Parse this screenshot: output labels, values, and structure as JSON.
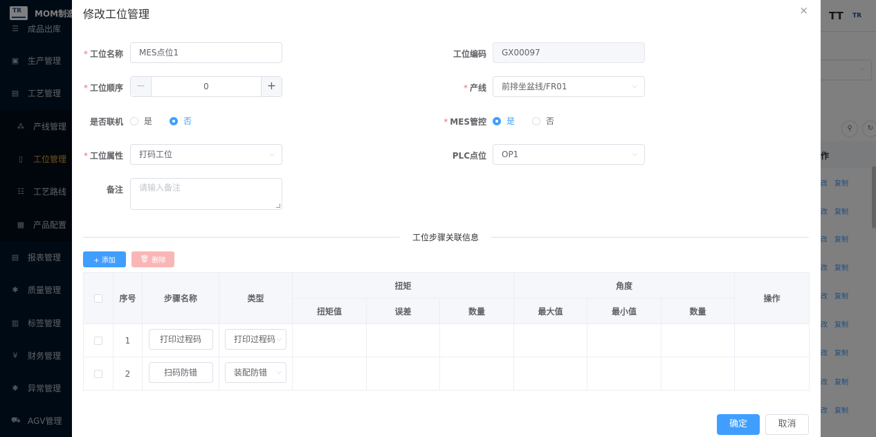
{
  "app": {
    "title": "MOM制造",
    "logo_text": "TR"
  },
  "sidebar": {
    "items": [
      {
        "label": "成品出库",
        "icon": "list-icon"
      },
      {
        "label": "生产管理",
        "icon": "box-icon"
      },
      {
        "label": "工艺管理",
        "icon": "card-icon"
      },
      {
        "label": "产线管理",
        "icon": "tree-icon"
      },
      {
        "label": "工位管理",
        "icon": "station-icon"
      },
      {
        "label": "工艺路线",
        "icon": "route-icon"
      },
      {
        "label": "产品配置",
        "icon": "config-icon"
      },
      {
        "label": "报表管理",
        "icon": "report-icon"
      },
      {
        "label": "质量管理",
        "icon": "quality-icon"
      },
      {
        "label": "标签管理",
        "icon": "tag-icon"
      },
      {
        "label": "财务管理",
        "icon": "yen-icon"
      },
      {
        "label": "异常管理",
        "icon": "alert-icon"
      },
      {
        "label": "AGV管理",
        "icon": "cart-icon"
      }
    ]
  },
  "background": {
    "toolbar_icon": "TT",
    "table_header": "作",
    "row_actions": {
      "edit": "改",
      "copy": "复制"
    }
  },
  "dialog": {
    "title": "修改工位管理",
    "close": "×",
    "form": {
      "name_label": "工位名称",
      "name_value": "MES点位1",
      "code_label": "工位编码",
      "code_value": "GX00097",
      "order_label": "工位顺序",
      "order_value": "0",
      "line_label": "产线",
      "line_value": "前排坐盆线/FR01",
      "online_label": "是否联机",
      "online_options": [
        "是",
        "否"
      ],
      "mes_label": "MES管控",
      "mes_options": [
        "是",
        "否"
      ],
      "attr_label": "工位属性",
      "attr_value": "打码工位",
      "plc_label": "PLC点位",
      "plc_value": "OP1",
      "remark_label": "备注",
      "remark_placeholder": "请输入备注"
    },
    "section_title": "工位步骤关联信息",
    "add_label": "+ 添加",
    "delete_label": "删除",
    "table": {
      "col_index": "序号",
      "col_step": "步骤名称",
      "col_type": "类型",
      "group_torque": "扭矩",
      "group_angle": "角度",
      "col_action": "操作",
      "torque_cols": [
        "扭矩值",
        "误差",
        "数量"
      ],
      "angle_cols": [
        "最大值",
        "最小值",
        "数量"
      ],
      "rows": [
        {
          "index": "1",
          "step": "打印过程码",
          "type": "打印过程码"
        },
        {
          "index": "2",
          "step": "扫码防错",
          "type": "装配防错"
        }
      ]
    },
    "ok_label": "确定",
    "cancel_label": "取消"
  }
}
